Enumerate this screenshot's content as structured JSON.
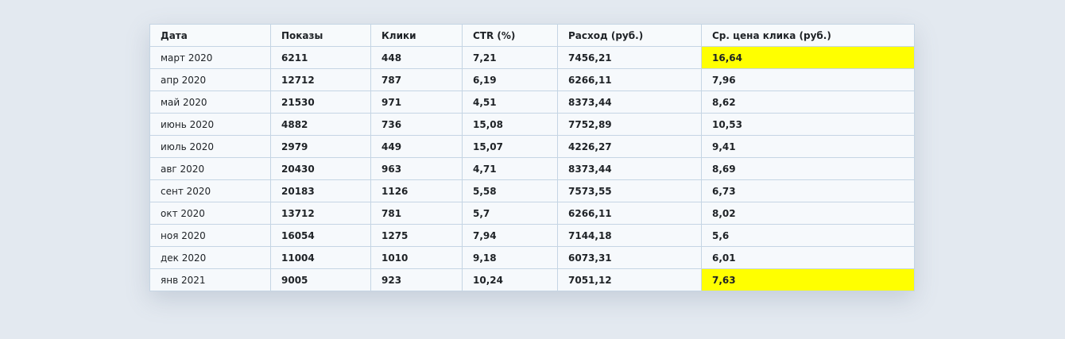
{
  "table": {
    "headers": [
      "Дата",
      "Показы",
      "Клики",
      "CTR (%)",
      "Расход (руб.)",
      "Ср. цена клика (руб.)"
    ],
    "rows": [
      [
        "март 2020",
        "6211",
        "448",
        "7,21",
        "7456,21",
        "16,64"
      ],
      [
        "апр 2020",
        "12712",
        "787",
        "6,19",
        "6266,11",
        "7,96"
      ],
      [
        "май 2020",
        "21530",
        "971",
        "4,51",
        "8373,44",
        "8,62"
      ],
      [
        "июнь 2020",
        "4882",
        "736",
        "15,08",
        "7752,89",
        "10,53"
      ],
      [
        "июль 2020",
        "2979",
        "449",
        "15,07",
        "4226,27",
        "9,41"
      ],
      [
        "авг 2020",
        "20430",
        "963",
        "4,71",
        "8373,44",
        "8,69"
      ],
      [
        "сент 2020",
        "20183",
        "1126",
        "5,58",
        "7573,55",
        "6,73"
      ],
      [
        "окт 2020",
        "13712",
        "781",
        "5,7",
        "6266,11",
        "8,02"
      ],
      [
        "ноя 2020",
        "16054",
        "1275",
        "7,94",
        "7144,18",
        "5,6"
      ],
      [
        "дек 2020",
        "11004",
        "1010",
        "9,18",
        "6073,31",
        "6,01"
      ],
      [
        "янв 2021",
        "9005",
        "923",
        "10,24",
        "7051,12",
        "7,63"
      ]
    ],
    "highlight_color": "#ffff00",
    "highlighted_cells": [
      [
        0,
        5
      ],
      [
        10,
        5
      ]
    ]
  }
}
